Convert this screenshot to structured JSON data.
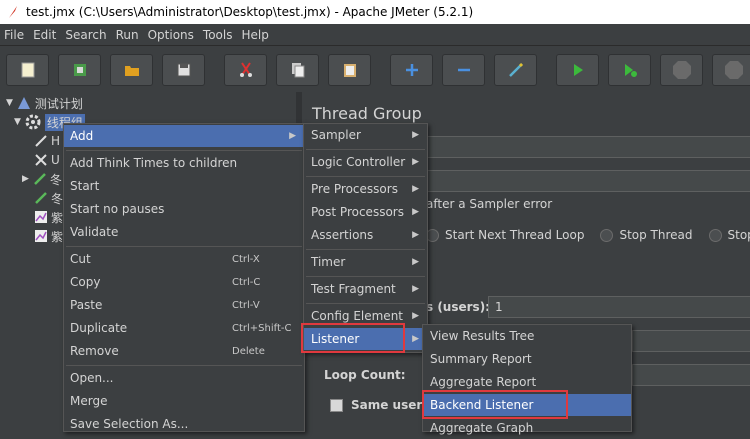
{
  "window": {
    "title": "test.jmx (C:\\Users\\Administrator\\Desktop\\test.jmx) - Apache JMeter (5.2.1)"
  },
  "menu": [
    "File",
    "Edit",
    "Search",
    "Run",
    "Options",
    "Tools",
    "Help"
  ],
  "tree": {
    "root": "测试计划",
    "thread_group": "线程组",
    "truncated": [
      "H",
      "U",
      "冬",
      "冬",
      "紫",
      "紫"
    ]
  },
  "panel": {
    "title": "Thread Group",
    "error_label": "after a Sampler error",
    "radios": [
      "Start Next Thread Loop",
      "Stop Thread",
      "Stop T"
    ],
    "threads_label": "s (users):",
    "threads_value": "1",
    "loop_label": "Loop Count:",
    "same_user_label": "Same user o"
  },
  "context_menu": {
    "items": [
      {
        "label": "Add",
        "shortcut": ""
      },
      {
        "label": "Add Think Times to children",
        "shortcut": ""
      },
      {
        "label": "Start",
        "shortcut": ""
      },
      {
        "label": "Start no pauses",
        "shortcut": ""
      },
      {
        "label": "Validate",
        "shortcut": ""
      },
      {
        "label": "Cut",
        "shortcut": "Ctrl-X"
      },
      {
        "label": "Copy",
        "shortcut": "Ctrl-C"
      },
      {
        "label": "Paste",
        "shortcut": "Ctrl-V"
      },
      {
        "label": "Duplicate",
        "shortcut": "Ctrl+Shift-C"
      },
      {
        "label": "Remove",
        "shortcut": "Delete"
      },
      {
        "label": "Open...",
        "shortcut": ""
      },
      {
        "label": "Merge",
        "shortcut": ""
      },
      {
        "label": "Save Selection As...",
        "shortcut": ""
      }
    ]
  },
  "add_submenu": [
    "Sampler",
    "Logic Controller",
    "Pre Processors",
    "Post Processors",
    "Assertions",
    "Timer",
    "Test Fragment",
    "Config Element",
    "Listener"
  ],
  "listener_submenu": [
    "View Results Tree",
    "Summary Report",
    "Aggregate Report",
    "Backend Listener",
    "Aggregate Graph"
  ]
}
